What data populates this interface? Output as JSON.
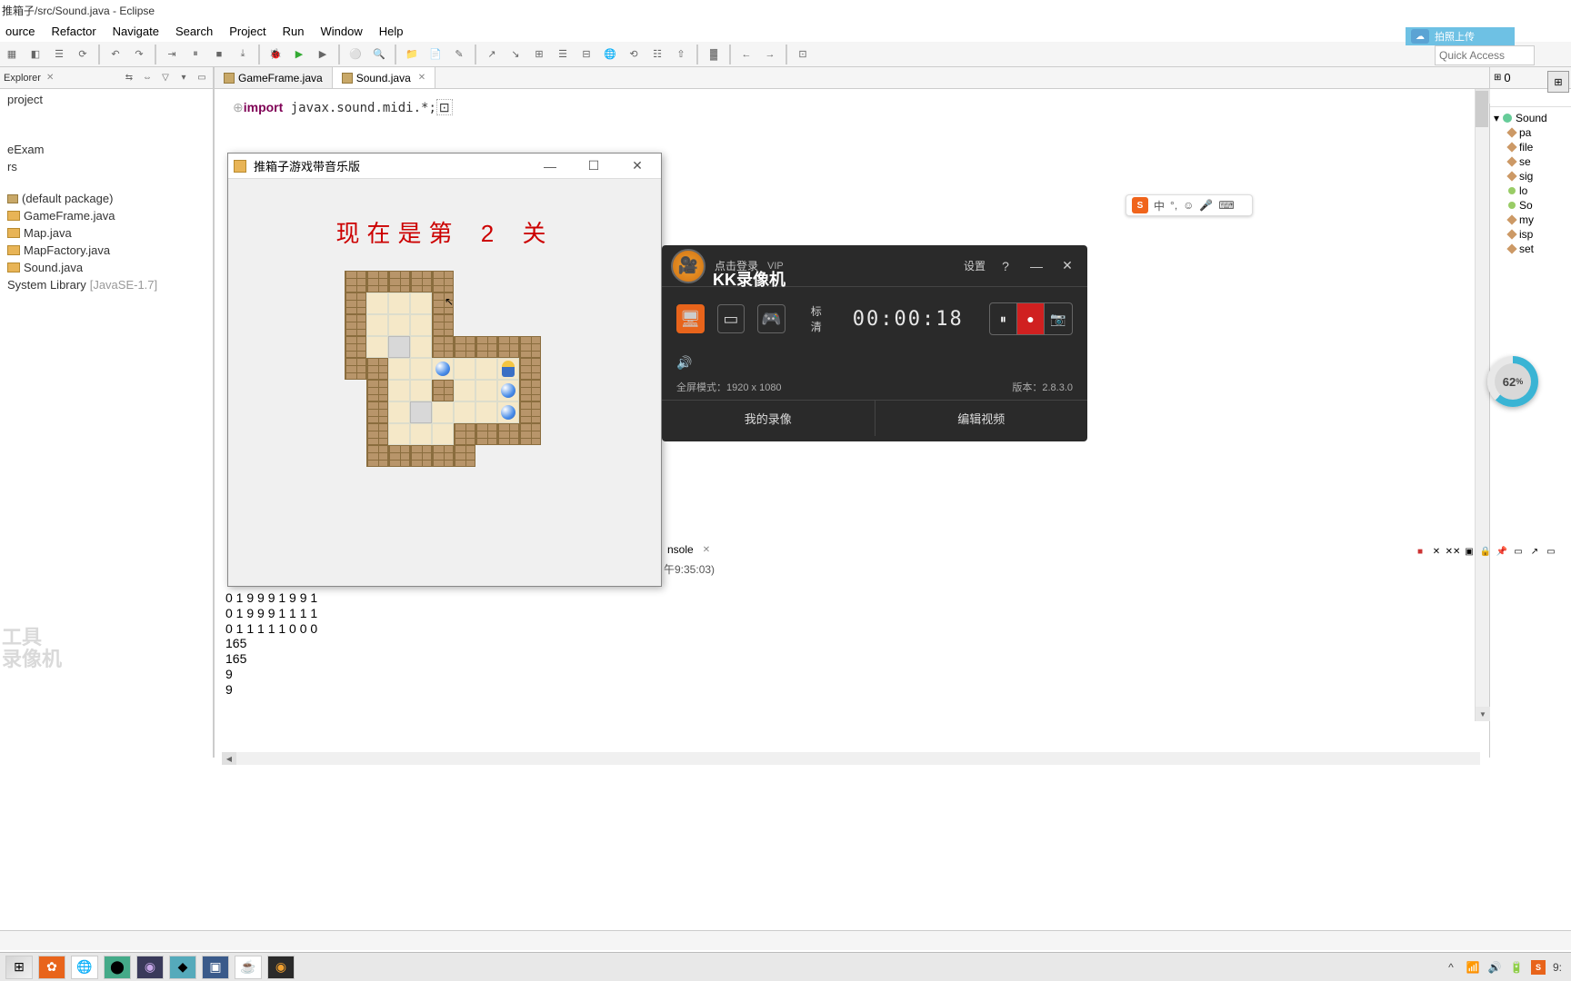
{
  "window": {
    "title": "推箱子/src/Sound.java - Eclipse"
  },
  "menubar": [
    "ource",
    "Refactor",
    "Navigate",
    "Search",
    "Project",
    "Run",
    "Window",
    "Help"
  ],
  "quick_access": {
    "placeholder": "Quick Access"
  },
  "cloud_button": {
    "label": "拍照上传"
  },
  "explorer": {
    "tab": "Explorer",
    "project": "project",
    "items": [
      {
        "label": "eExam"
      },
      {
        "label": "rs"
      },
      {
        "label": "(default package)"
      },
      {
        "label": "GameFrame.java"
      },
      {
        "label": "Map.java"
      },
      {
        "label": "MapFactory.java"
      },
      {
        "label": "Sound.java"
      },
      {
        "label": "System Library",
        "suffix": "[JavaSE-1.7]"
      }
    ]
  },
  "editor": {
    "tabs": [
      {
        "label": "GameFrame.java",
        "active": false
      },
      {
        "label": "Sound.java",
        "active": true
      }
    ],
    "code_line": "import javax.sound.midi.*;"
  },
  "outline": {
    "counter": "0",
    "root": "Sound",
    "items": [
      "pa",
      "file",
      "se",
      "sig",
      "lo",
      "So",
      "my",
      "isp",
      "set"
    ]
  },
  "game": {
    "title": "推箱子游戏带音乐版",
    "level_prefix": "现在是第",
    "level_number": "2",
    "level_suffix": "关",
    "map": [
      "WWWWW....",
      "WFFFW....",
      "WFFFW....",
      "WFTFWWWWW",
      "WWFFBFFPW",
      ".WFFWFFBW",
      ".WFTFFFBW",
      ".WFFFWWWW",
      ".WWWWW..."
    ]
  },
  "recorder": {
    "login": "点击登录",
    "vip": "VIP",
    "brand": "KK录像机",
    "settings": "设置",
    "quality": "标清",
    "time": "00:00:18",
    "mode_label": "全屏模式：1920 x 1080",
    "version_label": "版本：2.8.3.0",
    "my_recordings": "我的录像",
    "edit_video": "编辑视频"
  },
  "ime": {
    "lang": "中"
  },
  "progress": {
    "pct": "62",
    "suffix": "%"
  },
  "console": {
    "tab": "nsole",
    "terminated_suffix": "午9:35:03)",
    "lines": [
      "0 1 9 9 9 1 9 9 1",
      "0 1 9 9 9 1 1 1 1",
      "0 1 1 1 1 1 0 0 0",
      "165",
      "165",
      "9",
      "9"
    ]
  },
  "watermark": {
    "line1": "工具",
    "line2": "录像机"
  },
  "taskbar": {
    "time": "9:"
  },
  "colors": {
    "accent": "#e8641b",
    "brand_red": "#c00"
  }
}
